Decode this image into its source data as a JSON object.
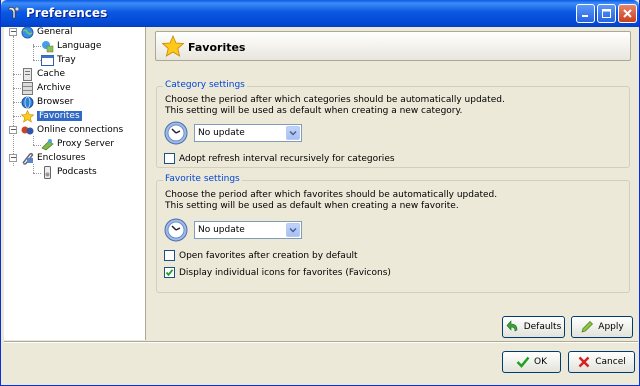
{
  "window": {
    "title": "Preferences"
  },
  "tree": {
    "items": [
      {
        "label": "General",
        "icon": "globe-icon"
      },
      {
        "label": "Language",
        "icon": "language-icon"
      },
      {
        "label": "Tray",
        "icon": "tray-icon"
      },
      {
        "label": "Cache",
        "icon": "cache-icon"
      },
      {
        "label": "Archive",
        "icon": "archive-icon"
      },
      {
        "label": "Browser",
        "icon": "browser-icon"
      },
      {
        "label": "Favorites",
        "icon": "star-icon",
        "selected": true
      },
      {
        "label": "Online connections",
        "icon": "network-icon"
      },
      {
        "label": "Proxy Server",
        "icon": "proxy-icon"
      },
      {
        "label": "Enclosures",
        "icon": "enclosure-icon"
      },
      {
        "label": "Podcasts",
        "icon": "podcast-icon"
      }
    ]
  },
  "header": {
    "title": "Favorites",
    "icon": "star-icon"
  },
  "category_settings": {
    "title": "Category settings",
    "desc_line1": "Choose the period after which categories should be automatically updated.",
    "desc_line2": "This setting will be used as default when creating a new category.",
    "period_value": "No update",
    "adopt_label": "Adopt refresh interval recursively for categories",
    "adopt_checked": false
  },
  "favorite_settings": {
    "title": "Favorite settings",
    "desc_line1": "Choose the period after which favorites should be automatically updated.",
    "desc_line2": "This setting will be used as default when creating a new favorite.",
    "period_value": "No update",
    "open_label": "Open favorites after creation by default",
    "open_checked": false,
    "favicons_label": "Display individual icons for favorites (Favicons)",
    "favicons_checked": true
  },
  "buttons": {
    "defaults": "Defaults",
    "apply": "Apply",
    "ok": "OK",
    "cancel": "Cancel"
  },
  "colors": {
    "titlebar": "#0a58e2",
    "selection": "#316ac5",
    "group_title": "#0046d5",
    "face": "#ece9d8"
  }
}
